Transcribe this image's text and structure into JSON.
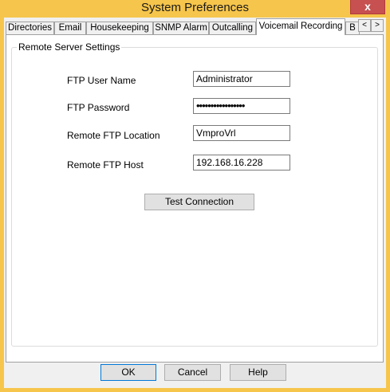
{
  "window": {
    "title": "System Preferences",
    "close_glyph": "x"
  },
  "tabs": [
    {
      "label": "Directories"
    },
    {
      "label": "Email"
    },
    {
      "label": "Housekeeping"
    },
    {
      "label": "SNMP Alarm"
    },
    {
      "label": "Outcalling"
    },
    {
      "label": "Voicemail Recording",
      "active": true
    },
    {
      "label": "B"
    }
  ],
  "tab_scroll": {
    "left": "<",
    "right": ">"
  },
  "group": {
    "label": "Remote Server Settings"
  },
  "fields": {
    "ftp_user_name": {
      "label": "FTP User Name",
      "value": "Administrator"
    },
    "ftp_password": {
      "label": "FTP Password",
      "value": "•••••••••••••••••"
    },
    "remote_ftp_location": {
      "label": "Remote FTP Location",
      "value": "VmproVrl"
    },
    "remote_ftp_host": {
      "label": "Remote FTP Host",
      "value": "192.168.16.228"
    }
  },
  "test_connection_label": "Test Connection",
  "buttons": {
    "ok": "OK",
    "cancel": "Cancel",
    "help": "Help"
  }
}
